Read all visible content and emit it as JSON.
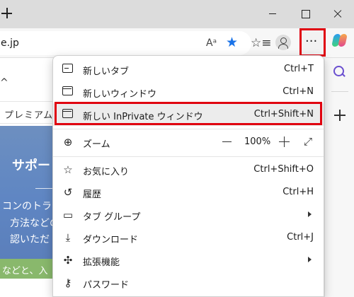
{
  "toolbar": {
    "url": "e.jp",
    "read_aloud_icon": "Aᵃ",
    "favorite_icon": "★",
    "collections_icon": "☆≡",
    "more_label": "···"
  },
  "page": {
    "nav_item": "プレミアム",
    "hero_title": "サポート",
    "hero_line1": "コンのトラ",
    "hero_line2": "方法などの",
    "hero_line3": "認いただ",
    "green_text": "などと、入"
  },
  "menu": {
    "items": [
      {
        "label": "新しいタブ",
        "shortcut": "Ctrl+T"
      },
      {
        "label": "新しいウィンドウ",
        "shortcut": "Ctrl+N"
      },
      {
        "label": "新しい InPrivate ウィンドウ",
        "shortcut": "Ctrl+Shift+N"
      },
      {
        "label": "ズーム",
        "shortcut": ""
      },
      {
        "label": "お気に入り",
        "shortcut": "Ctrl+Shift+O"
      },
      {
        "label": "履歴",
        "shortcut": "Ctrl+H"
      },
      {
        "label": "タブ グループ",
        "shortcut": ""
      },
      {
        "label": "ダウンロード",
        "shortcut": "Ctrl+J"
      },
      {
        "label": "拡張機能",
        "shortcut": ""
      },
      {
        "label": "パスワード",
        "shortcut": ""
      }
    ],
    "zoom_value": "100%"
  },
  "colors": {
    "highlight_red": "#e0000f",
    "favorite_blue": "#1a73e8"
  }
}
